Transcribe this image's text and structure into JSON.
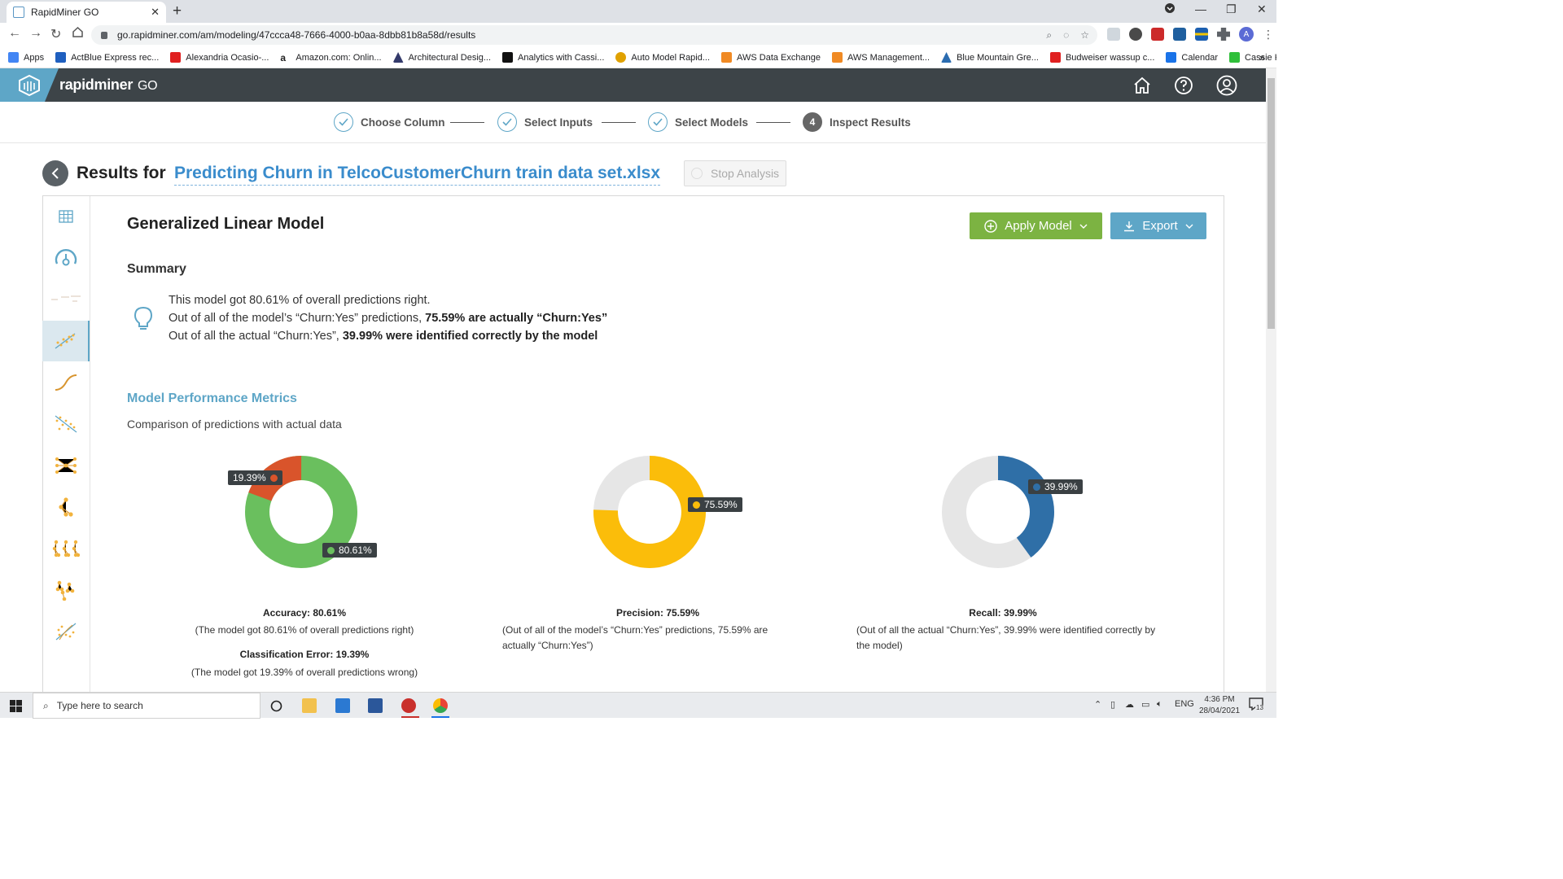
{
  "browser": {
    "tab_title": "RapidMiner GO",
    "new_tab": "+",
    "url": "go.rapidminer.com/am/modeling/47ccca48-7666-4000-b0aa-8dbb81b8a58d/results",
    "bookmarks": [
      {
        "label": "Apps",
        "color": "#4285f4"
      },
      {
        "label": "ActBlue Express rec...",
        "color": "#1f5fbf"
      },
      {
        "label": "Alexandria Ocasio-...",
        "color": "#e02020"
      },
      {
        "label": "Amazon.com: Onlin...",
        "color": "#222222"
      },
      {
        "label": "Architectural Desig...",
        "color": "#333a6b"
      },
      {
        "label": "Analytics with Cassi...",
        "color": "#111111"
      },
      {
        "label": "Auto Model Rapid...",
        "color": "#e0a100"
      },
      {
        "label": "AWS Data Exchange",
        "color": "#f08a24"
      },
      {
        "label": "AWS Management...",
        "color": "#f08a24"
      },
      {
        "label": "Blue Mountain Gre...",
        "color": "#2b6cb0"
      },
      {
        "label": "Budweiser wassup c...",
        "color": "#e02020"
      },
      {
        "label": "Calendar",
        "color": "#1a73e8"
      },
      {
        "label": "Cassie Kozyrkov in...",
        "color": "#2fbf3a"
      }
    ],
    "bookmarks_more": "»",
    "profile_initial": "A"
  },
  "app": {
    "brand": "rapidminer",
    "brand_suffix": "GO"
  },
  "steps": [
    {
      "label": "Choose Column",
      "done": true
    },
    {
      "label": "Select Inputs",
      "done": true
    },
    {
      "label": "Select Models",
      "done": true
    },
    {
      "label": "Inspect Results",
      "number": "4"
    }
  ],
  "results": {
    "prefix": "Results for",
    "title": "Predicting Churn in TelcoCustomerChurn train data set.xlsx",
    "stop_label": "Stop Analysis"
  },
  "model": {
    "title": "Generalized Linear Model",
    "apply_label": "Apply Model",
    "export_label": "Export",
    "summary_heading": "Summary",
    "summary_line1": "This model got 80.61% of overall predictions right.",
    "summary_line2_pre": "Out of all of the model’s “Churn:Yes” predictions, ",
    "summary_line2_bold": "75.59% are actually “Churn:Yes”",
    "summary_line3_pre": "Out of all the actual “Churn:Yes”, ",
    "summary_line3_bold": "39.99% were identified correctly by the model",
    "metrics_heading": "Model Performance Metrics",
    "metrics_sub": "Comparison of predictions with actual data"
  },
  "metrics": {
    "accuracy": {
      "title": "Accuracy: 80.61%",
      "desc": "(The model got 80.61% of overall predictions right)",
      "value": 80.61,
      "tip_main": "80.61%",
      "tip_rest": "19.39%",
      "color": "#6abf5e",
      "rest_color": "#d9542b"
    },
    "error": {
      "title": "Classification Error: 19.39%",
      "desc": "(The model got 19.39% of overall predictions wrong)"
    },
    "precision": {
      "title": "Precision: 75.59%",
      "desc": "(Out of all of the model’s “Churn:Yes” predictions, 75.59% are actually “Churn:Yes”)",
      "value": 75.59,
      "tip_main": "75.59%",
      "color": "#fbbd0a",
      "rest_color": "#e6e6e6"
    },
    "recall": {
      "title": "Recall: 39.99%",
      "desc": "(Out of all the actual “Churn:Yes”, 39.99% were identified correctly by the model)",
      "value": 39.99,
      "tip_main": "39.99%",
      "color": "#2f6fa7",
      "rest_color": "#e6e6e6"
    }
  },
  "taskbar": {
    "search_placeholder": "Type here to search",
    "lang": "ENG",
    "time": "4:36 PM",
    "date": "28/04/2021",
    "notif_count": "13"
  }
}
